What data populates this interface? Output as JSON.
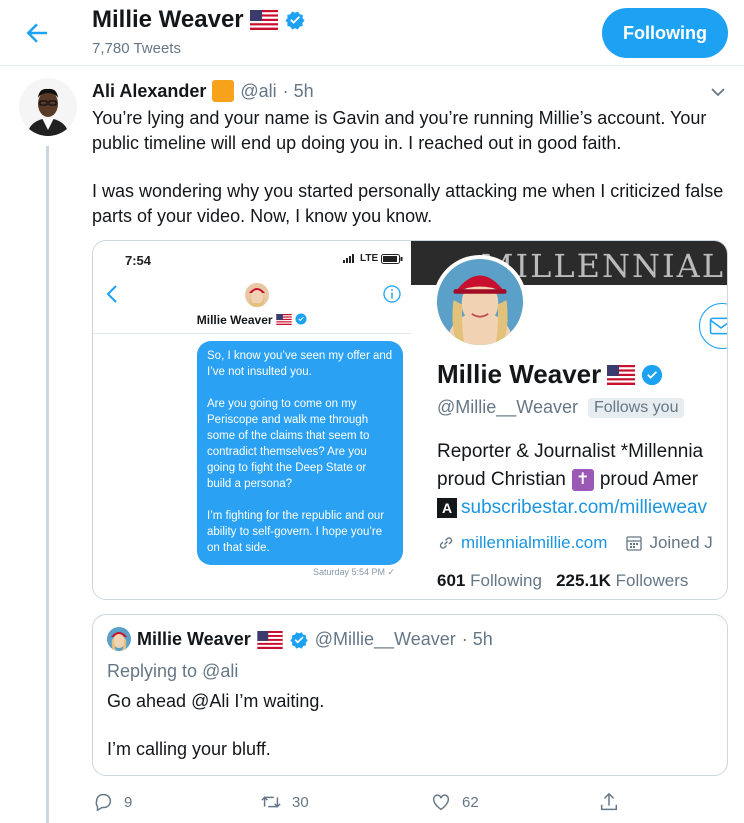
{
  "header": {
    "name": "Millie Weaver",
    "tweet_count": "7,780 Tweets",
    "follow_label": "Following"
  },
  "tweet": {
    "author": "Ali Alexander",
    "handle": "@ali",
    "time": "· 5h",
    "paragraph1": "You’re lying and your name is Gavin and you’re running Millie’s account. Your public timeline will end up doing you in. I reached out in good faith.",
    "paragraph2": "I was wondering why you started personally attacking me when I criticized false parts of your video. Now, I know you know."
  },
  "screenshot": {
    "phone": {
      "time": "7:54",
      "network": "LTE",
      "contact_name": "Millie Weaver",
      "messages": [
        "So, I know you’ve seen my offer and I’ve not insulted you.",
        "Are you going to come on my Periscope and walk me through some of the claims that seem to contradict themselves? Are you going to fight the Deep State or build a persona?",
        "I’m fighting for the republic and our ability to self-govern. I hope you’re on that side."
      ],
      "timestamp": "Saturday 5:54 PM ✓"
    },
    "profile": {
      "banner_text": "MILLENNIAL",
      "name": "Millie Weaver",
      "handle": "@Millie__Weaver",
      "follows_you": "Follows you",
      "bio_line1": "Reporter & Journalist *Millennia",
      "bio_line2_a": "proud Christian",
      "bio_line2_b": "proud Amer",
      "bio_line3": "subscribestar.com/millieweav",
      "website": "millennialmillie.com",
      "joined": "Joined J",
      "following_count": "601",
      "following_label": "Following",
      "followers_count": "225.1K",
      "followers_label": "Followers"
    }
  },
  "quote": {
    "author": "Millie Weaver",
    "handle": "@Millie__Weaver",
    "time": "· 5h",
    "replying_to_label": "Replying to",
    "replying_to_handle": "@ali",
    "line1": "Go ahead @Ali I’m waiting.",
    "line2": "I’m calling your bluff."
  },
  "actions": {
    "reply_count": "9",
    "retweet_count": "30",
    "like_count": "62"
  },
  "colors": {
    "accent": "#1da1f2",
    "muted": "#657786",
    "border": "#ccd6dd",
    "orange_badge": "#f7a21b"
  },
  "icons": [
    "back-arrow-icon",
    "verified-icon",
    "us-flag-icon",
    "chevron-down-icon",
    "reply-icon",
    "retweet-icon",
    "like-icon",
    "share-icon",
    "link-icon",
    "calendar-icon",
    "envelope-icon"
  ]
}
